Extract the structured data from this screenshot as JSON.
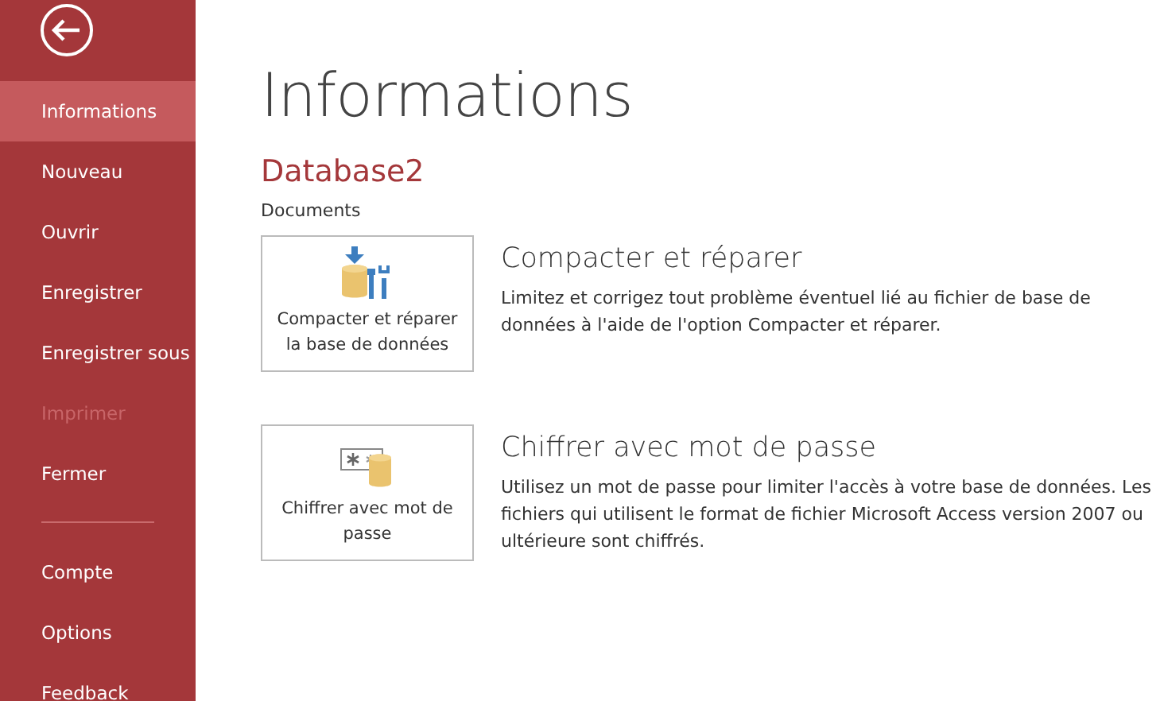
{
  "sidebar": {
    "groups": [
      [
        {
          "label": "Informations",
          "selected": true,
          "disabled": false
        },
        {
          "label": "Nouveau",
          "selected": false,
          "disabled": false
        },
        {
          "label": "Ouvrir",
          "selected": false,
          "disabled": false
        },
        {
          "label": "Enregistrer",
          "selected": false,
          "disabled": false
        },
        {
          "label": "Enregistrer sous",
          "selected": false,
          "disabled": false
        },
        {
          "label": "Imprimer",
          "selected": false,
          "disabled": true
        },
        {
          "label": "Fermer",
          "selected": false,
          "disabled": false
        }
      ],
      [
        {
          "label": "Compte",
          "selected": false,
          "disabled": false
        },
        {
          "label": "Options",
          "selected": false,
          "disabled": false
        },
        {
          "label": "Feedback",
          "selected": false,
          "disabled": false
        }
      ]
    ]
  },
  "page": {
    "title": "Informations",
    "database": "Database2",
    "path": "Documents",
    "actions": [
      {
        "kind": "compact",
        "button": "Compacter et réparer la base de données",
        "heading": "Compacter et réparer",
        "description": "Limitez et corrigez tout problème éventuel lié au fichier de base de données à l'aide de l'option Compacter et réparer."
      },
      {
        "kind": "encrypt",
        "button": "Chiffrer avec mot de passe",
        "heading": "Chiffrer avec mot de passe",
        "description": "Utilisez un mot de passe pour limiter l'accès à votre base de données. Les fichiers qui utilisent le format de fichier Microsoft Access version 2007 ou ultérieure sont chiffrés."
      }
    ]
  }
}
